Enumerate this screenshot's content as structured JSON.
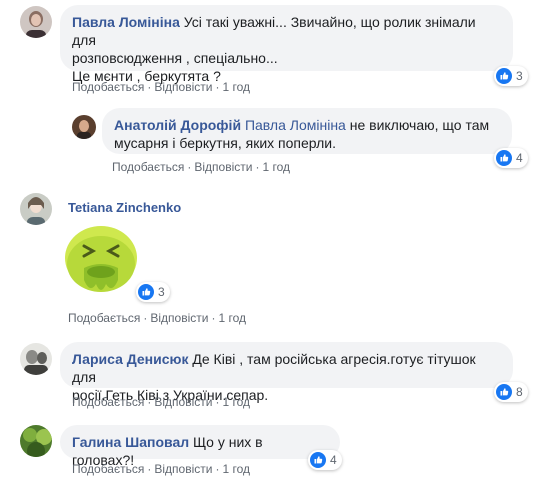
{
  "colors": {
    "author": "#385898",
    "bubble": "#f2f3f5",
    "meta": "#606770",
    "like": "#1877f2"
  },
  "comments": [
    {
      "author": "Павла Ломініна",
      "lines": [
        "Усі такі уважні... Звичайно, що ролик знімали для",
        "розповсюдження , спеціально...",
        "Це мєнти , беркутята ?"
      ],
      "reactions": "3",
      "actions": {
        "like": "Подобається",
        "reply": "Відповісти",
        "time": "1 год"
      },
      "reply": {
        "author": "Анатолій Дорофій",
        "mention": "Павла Ломініна",
        "lines": [
          "не виключаю, що там",
          "мусарня і беркутня, яких поперли."
        ],
        "reactions": "4",
        "actions": {
          "like": "Подобається",
          "reply": "Відповісти",
          "time": "1 год"
        }
      }
    },
    {
      "author": "Tetiana Zinchenko",
      "sticker": "sick-green-face-sticker",
      "reactions": "3",
      "actions": {
        "like": "Подобається",
        "reply": "Відповісти",
        "time": "1 год"
      }
    },
    {
      "author": "Лариса Денисюк",
      "lines": [
        "Де Ківі , там російська агресія.готує тітушок для",
        "росії.Геть Ківі з України.сепар."
      ],
      "reactions": "8",
      "actions": {
        "like": "Подобається",
        "reply": "Відповісти",
        "time": "1 год"
      }
    },
    {
      "author": "Галина Шаповал",
      "lines": [
        "Що у них в головах?!"
      ],
      "reactions": "4",
      "actions": {
        "like": "Подобається",
        "reply": "Відповісти",
        "time": "1 год"
      }
    }
  ]
}
